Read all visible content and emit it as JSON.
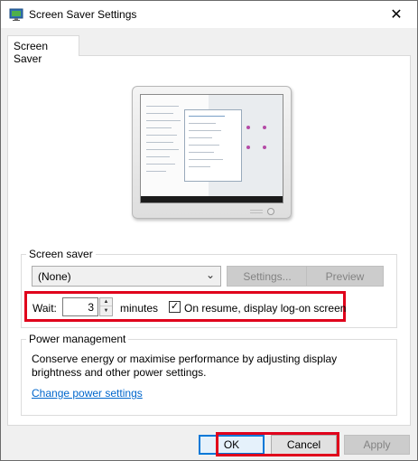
{
  "window": {
    "title": "Screen Saver Settings",
    "close_glyph": "✕"
  },
  "tabs": [
    {
      "label": "Screen Saver"
    }
  ],
  "screen_saver": {
    "group_label": "Screen saver",
    "selected": "(None)",
    "settings_label": "Settings...",
    "preview_label": "Preview",
    "wait_label": "Wait:",
    "wait_value": "3",
    "minutes_label": "minutes",
    "resume_label": "On resume, display log-on screen",
    "resume_checked": true
  },
  "power": {
    "group_label": "Power management",
    "description_line1": "Conserve energy or maximise performance by adjusting display",
    "description_line2": "brightness and other power settings.",
    "link_label": "Change power settings"
  },
  "buttons": {
    "ok": "OK",
    "cancel": "Cancel",
    "apply": "Apply"
  },
  "colors": {
    "highlight": "#e0001b",
    "link": "#0066cc",
    "accent": "#0078d7"
  }
}
